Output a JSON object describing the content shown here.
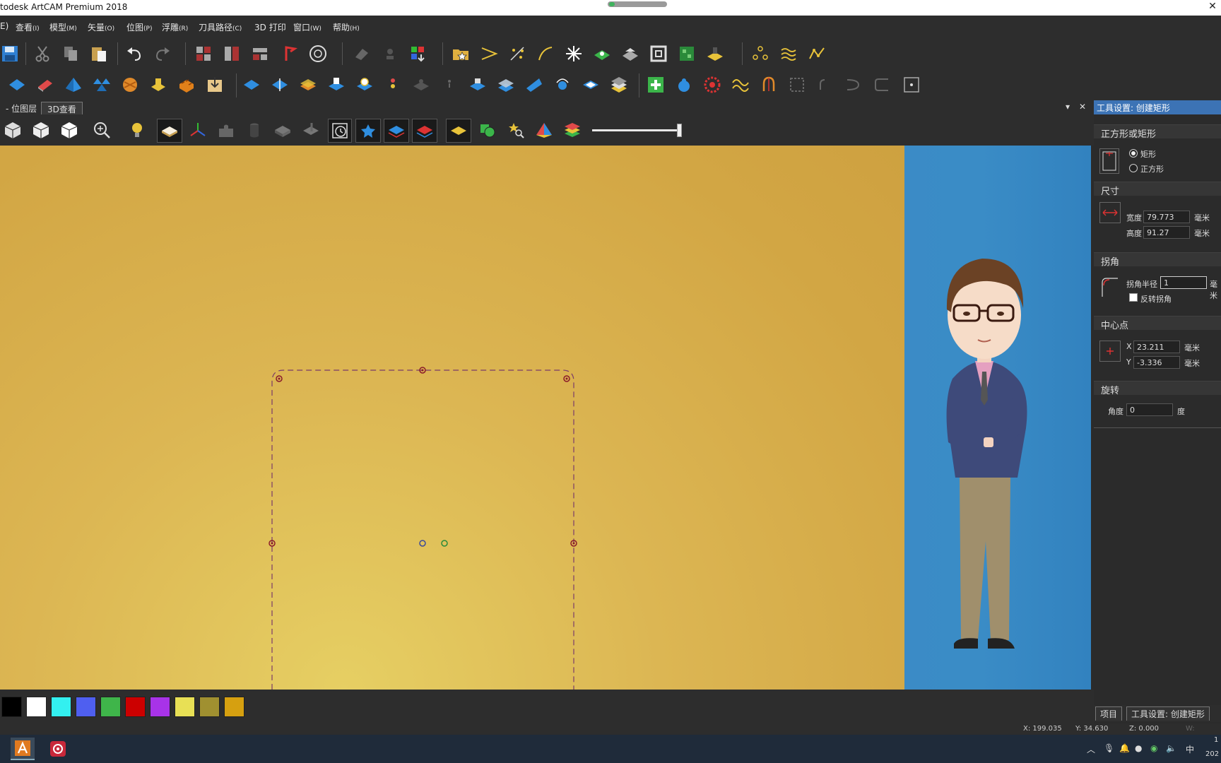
{
  "window": {
    "title": "todesk ArtCAM Premium 2018"
  },
  "menu": [
    {
      "label": "E)"
    },
    {
      "label": "查看",
      "key": "(I)"
    },
    {
      "label": "模型",
      "key": "(M)"
    },
    {
      "label": "矢量",
      "key": "(O)"
    },
    {
      "label": "位图",
      "key": "(P)"
    },
    {
      "label": "浮雕",
      "key": "(R)"
    },
    {
      "label": "刀具路径",
      "key": "(C)"
    },
    {
      "label": "3D 打印",
      "key": ""
    },
    {
      "label": "窗口",
      "key": "(W)"
    },
    {
      "label": "帮助",
      "key": "(H)"
    }
  ],
  "tabs": {
    "bitmap": "- 位图层",
    "view3d": "3D查看",
    "pin": "▾",
    "close": "✕"
  },
  "panel": {
    "header": "工具设置: 创建矩形",
    "shape_section": "正方形或矩形",
    "opt_rect": "矩形",
    "opt_square": "正方形",
    "size_section": "尺寸",
    "width_label": "宽度",
    "width_value": "79.773",
    "height_label": "高度",
    "height_value": "91.27",
    "unit": "毫米",
    "corner_section": "拐角",
    "corner_label": "拐角半径",
    "corner_value": "1",
    "corner_unit": "毫米",
    "invert_corner": "反转拐角",
    "center_section": "中心点",
    "x_label": "X",
    "x_value": "23.211",
    "y_label": "Y",
    "y_value": "-3.336",
    "rotate_section": "旋转",
    "angle_label": "角度",
    "angle_value": "0",
    "angle_unit": "度"
  },
  "panel_tabs": {
    "project": "项目",
    "tool": "工具设置: 创建矩形"
  },
  "palette": [
    "#000000",
    "#ffffff",
    "#33f0f0",
    "#4f5ff0",
    "#3fb54a",
    "#cc0000",
    "#a833e8",
    "#e8e055",
    "#a09030",
    "#d6a010"
  ],
  "status": {
    "x": "X: 199.035",
    "y": "Y: 34.630",
    "z": "Z: 0.000",
    "w": "W:"
  },
  "tray": {
    "ime": "中",
    "time": "1",
    "date": "202"
  },
  "colors": {
    "canvas": "#d6b04a",
    "presenter_bg": "#3a8cc6",
    "accent": "#3c73b5"
  }
}
